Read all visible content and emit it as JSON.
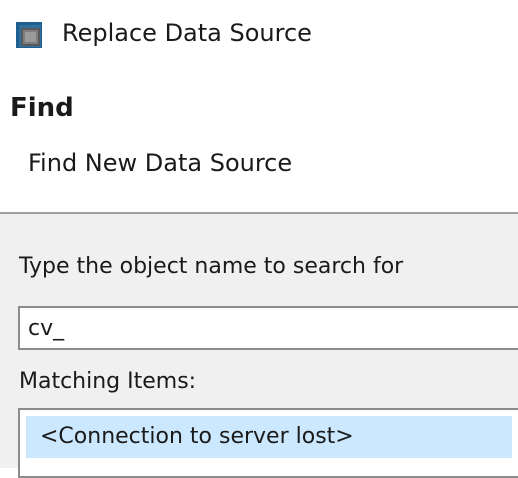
{
  "window": {
    "title": "Replace Data Source",
    "icon": "app-window-icon"
  },
  "header": {
    "section_title": "Find",
    "section_subtitle": "Find New Data Source"
  },
  "search": {
    "label": "Type the object name to search for",
    "value": "cv_"
  },
  "results": {
    "label": "Matching Items:",
    "items": [
      {
        "label": "<Connection to server lost>",
        "selected": true
      }
    ]
  },
  "colors": {
    "selection": "#cce8ff",
    "content_background": "#f0f0f0",
    "border": "#8c8c8c"
  }
}
